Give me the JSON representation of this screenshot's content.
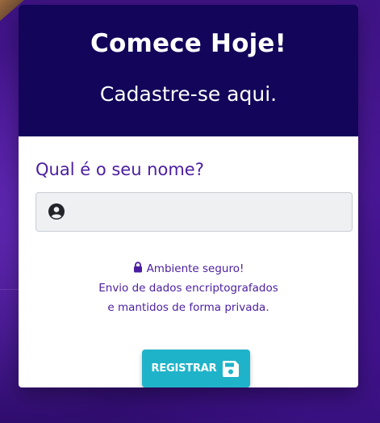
{
  "header": {
    "title": "Comece Hoje!",
    "subtitle": "Cadastre-se aqui."
  },
  "form": {
    "name_label": "Qual é o seu nome?",
    "name_value": "",
    "name_placeholder": ""
  },
  "security": {
    "line1": "Ambiente seguro!",
    "line2": "Envio de dados encriptografados",
    "line3": "e mantidos de forma privada."
  },
  "button": {
    "label": "REGISTRAR"
  },
  "icons": {
    "user": "user-circle-icon",
    "lock": "lock-icon",
    "save": "floppy-disk-icon"
  },
  "colors": {
    "header_bg": "#12055a",
    "accent_text": "#4b1ea0",
    "button_bg": "#1fb3c9"
  }
}
